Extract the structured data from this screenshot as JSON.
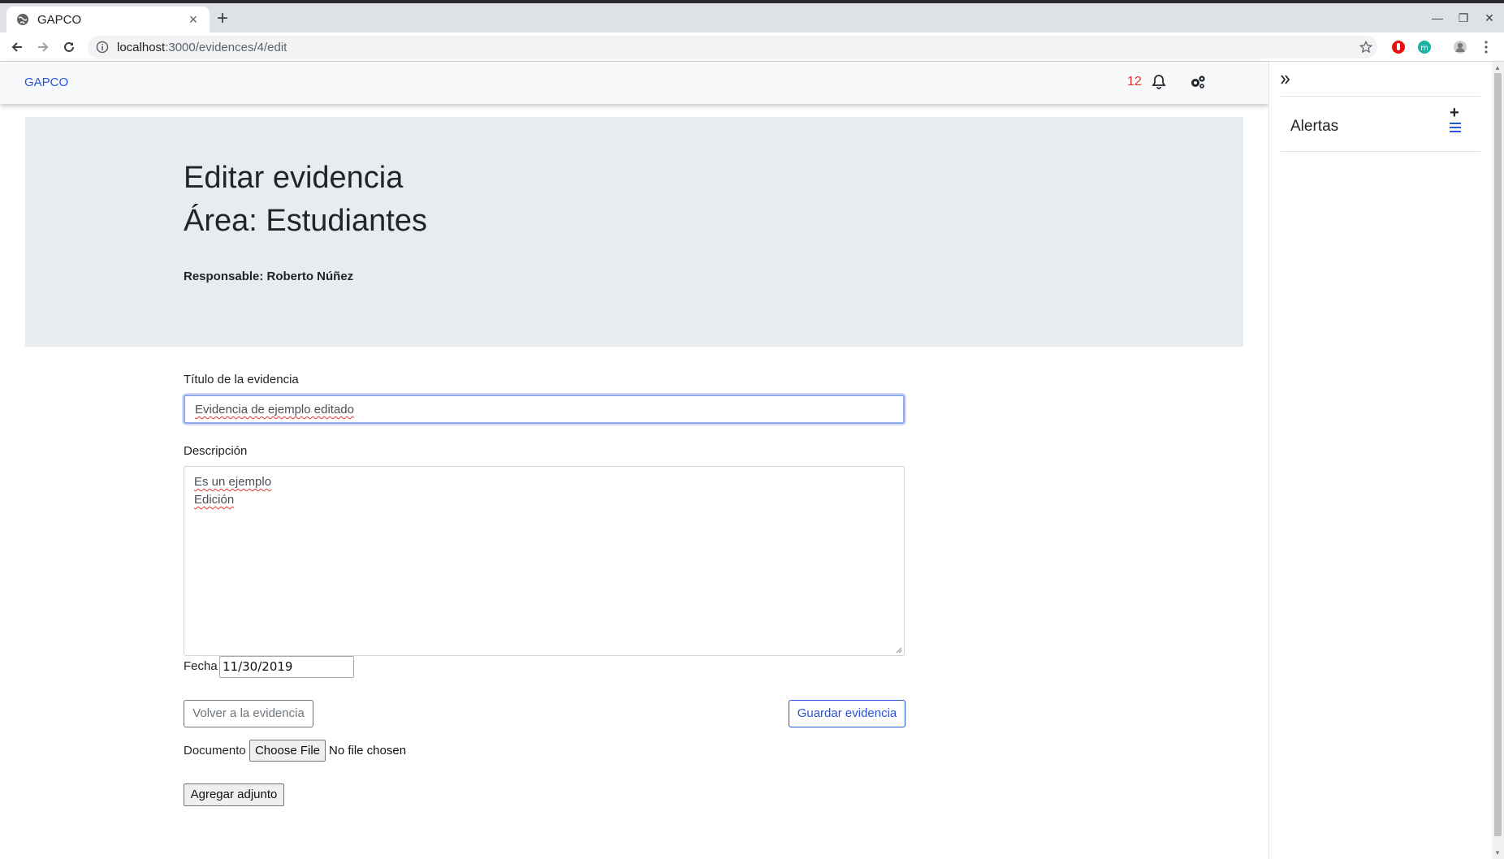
{
  "browser": {
    "tab_title": "GAPCO",
    "url_host": "localhost",
    "url_rest": ":3000/evidences/4/edit"
  },
  "navbar": {
    "brand": "GAPCO",
    "notification_count": "12"
  },
  "header": {
    "title": "Editar evidencia",
    "area": "Área: Estudiantes",
    "responsable": "Responsable: Roberto Núñez"
  },
  "form": {
    "title_label": "Título de la evidencia",
    "title_value": "Evidencia de ejemplo editado",
    "description_label": "Descripción",
    "description_line1": "Es un ejemplo",
    "description_line2": "Edición",
    "date_label": "Fecha",
    "date_value": "11/30/2019",
    "back_button": "Volver a la evidencia",
    "save_button": "Guardar evidencia",
    "document_label": "Documento",
    "choose_file_button": "Choose File",
    "file_status": "No file chosen",
    "attach_button": "Agregar adjunto"
  },
  "sidebar": {
    "title": "Alertas",
    "add_icon_glyph": "+"
  },
  "colors": {
    "brand": "#2953d9",
    "notification": "#e3342f",
    "jumbotron_bg": "#e9ecef"
  }
}
